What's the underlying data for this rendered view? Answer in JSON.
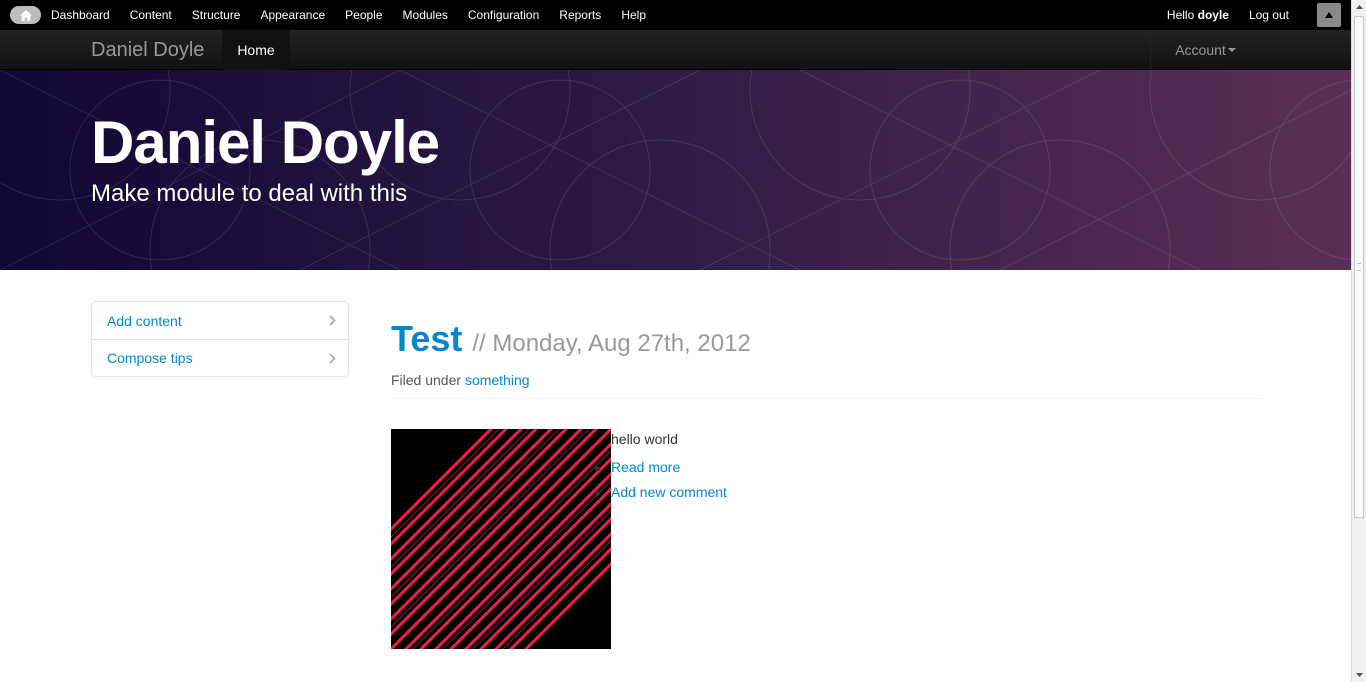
{
  "admin_toolbar": {
    "home_icon": "home-icon",
    "menu": [
      "Dashboard",
      "Content",
      "Structure",
      "Appearance",
      "People",
      "Modules",
      "Configuration",
      "Reports",
      "Help"
    ],
    "hello_prefix": "Hello",
    "username": "doyle",
    "logout_label": "Log out",
    "shortcut_icon": "triangle-up-icon"
  },
  "navbar": {
    "brand": "Daniel Doyle",
    "home_label": "Home",
    "account_label": "Account"
  },
  "hero": {
    "title": "Daniel Doyle",
    "slogan": "Make module to deal with this"
  },
  "sidebar": {
    "items": [
      {
        "label": "Add content"
      },
      {
        "label": "Compose tips"
      }
    ]
  },
  "article": {
    "title": "Test",
    "date": "// Monday, Aug 27th, 2012",
    "filed_prefix": "Filed under",
    "filed_term": "something",
    "body": "hello world",
    "links": [
      "Read more",
      "Add new comment"
    ]
  },
  "colors": {
    "link": "#0088cc",
    "toolbar": "#000000",
    "navbar": "#1b1b1b",
    "hero_start": "#0f0833",
    "hero_end": "#5a2f55"
  }
}
